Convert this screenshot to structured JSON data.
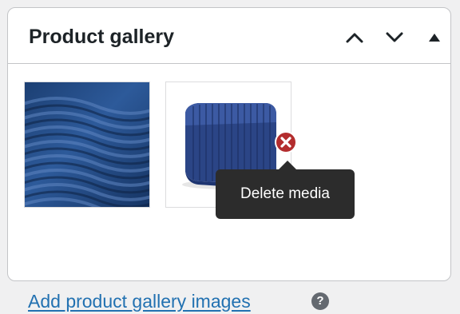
{
  "panel": {
    "title": "Product gallery",
    "controls": {
      "move_up": "chevron-up-icon",
      "move_down": "chevron-down-icon",
      "toggle": "triangle-up-icon"
    }
  },
  "gallery": {
    "images": [
      {
        "name": "blue-knit-fabric-closeup"
      },
      {
        "name": "folded-blue-knit-scarf"
      }
    ],
    "delete_icon": "delete-x-circle-icon",
    "tooltip": "Delete media"
  },
  "add_link": "Add product gallery images",
  "help_icon": {
    "name": "help-icon",
    "glyph": "?"
  },
  "colors": {
    "link": "#2271b1",
    "delete": "#b32d2e",
    "tooltip_bg": "#2c2c2c",
    "border": "#c3c4c7"
  }
}
